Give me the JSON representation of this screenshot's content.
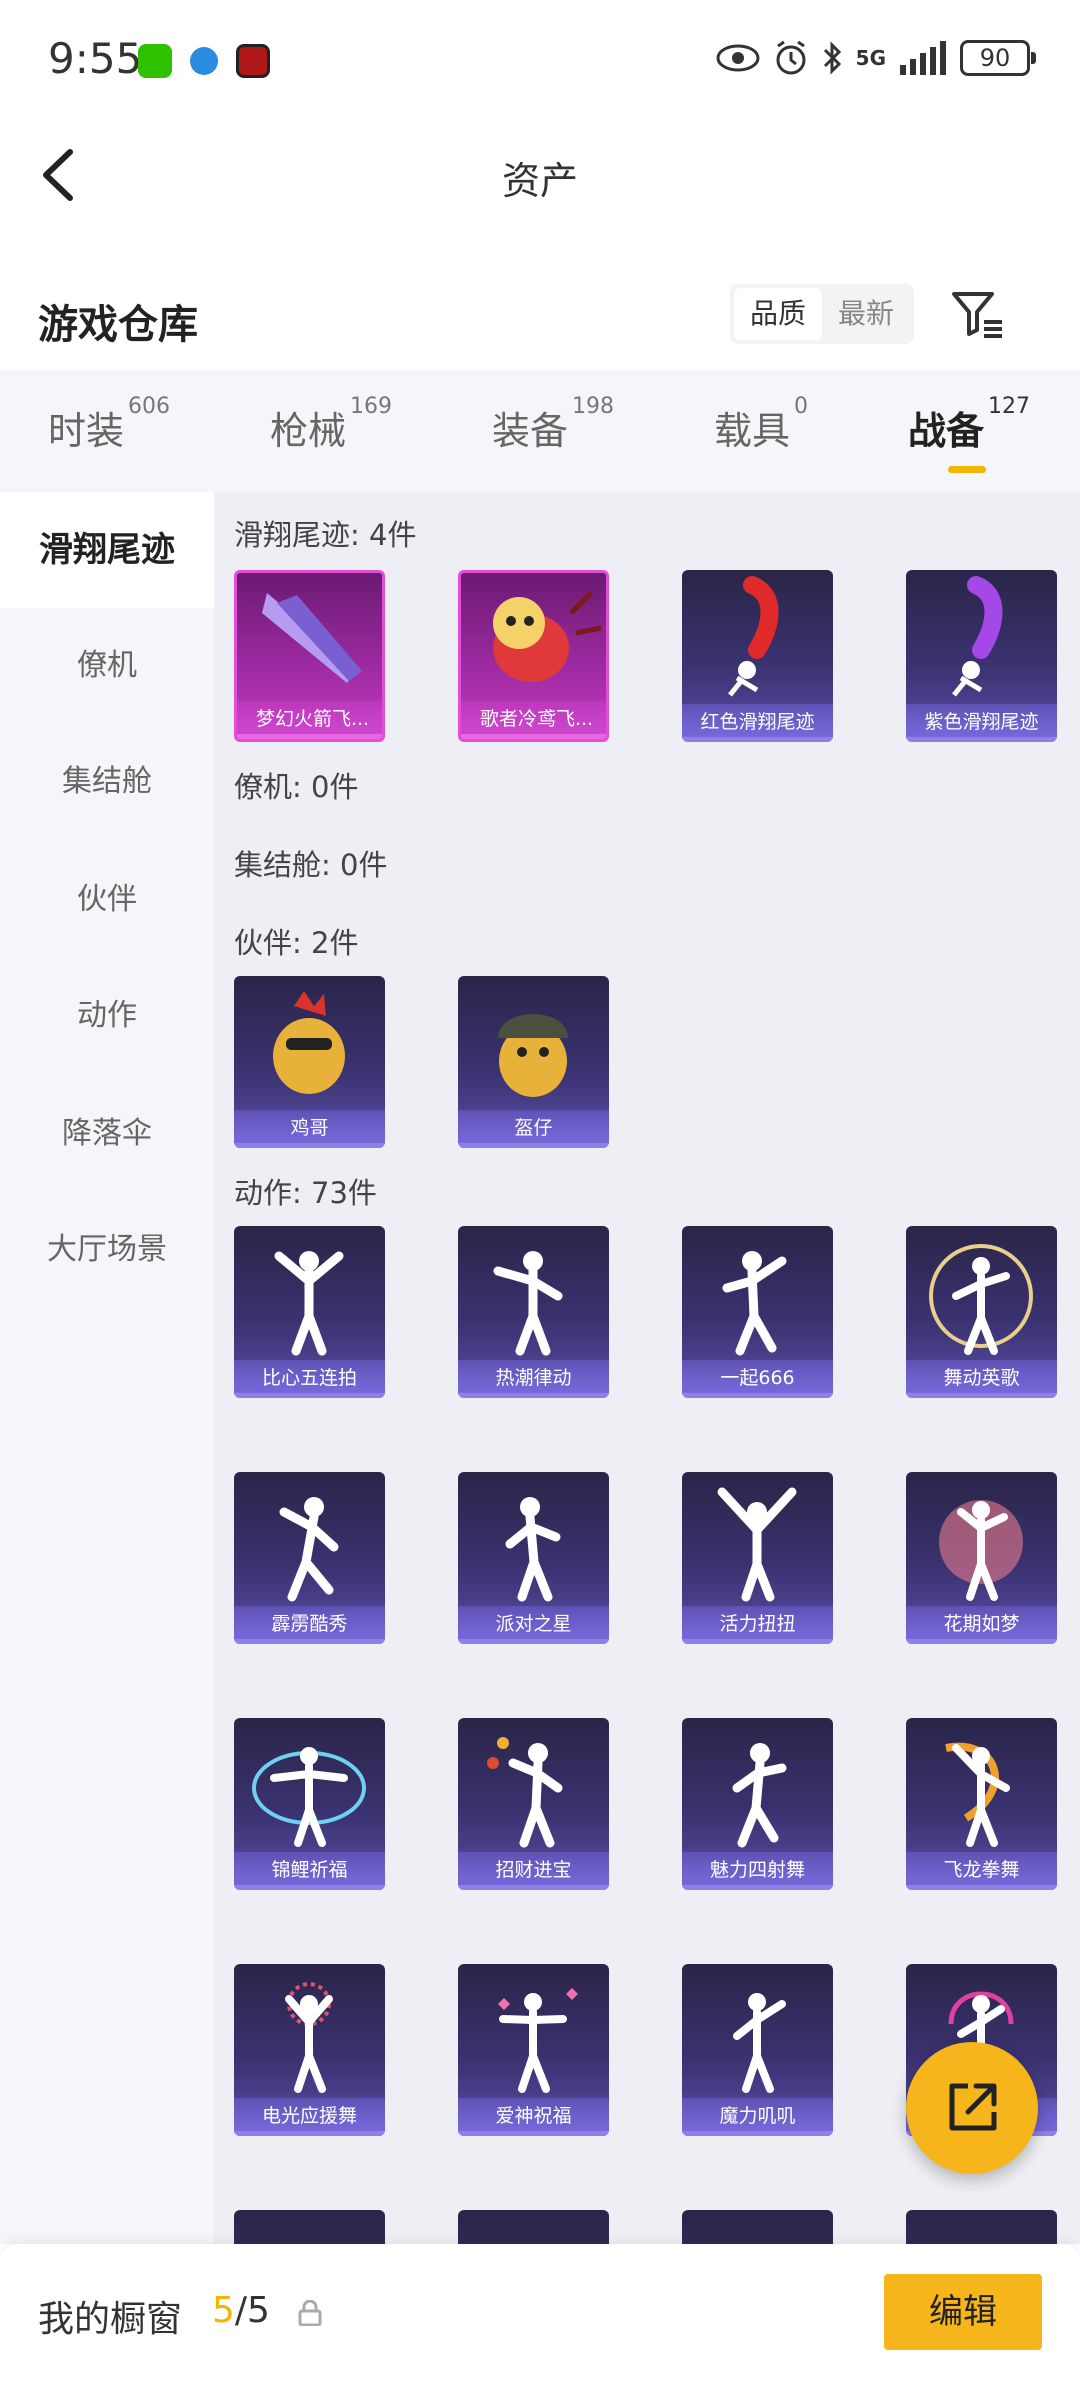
{
  "status_bar": {
    "time": "9:55",
    "network": "5G",
    "battery": "90",
    "app_icons": [
      "wechat-icon",
      "browser-icon",
      "game-app-icon"
    ],
    "system_icons": [
      "eye-icon",
      "alarm-icon",
      "bluetooth-icon",
      "signal-icon",
      "battery-icon"
    ]
  },
  "nav": {
    "title": "资产",
    "back_icon": "chevron-left-icon"
  },
  "warehouse": {
    "title": "游戏仓库",
    "sort_options": [
      "品质",
      "最新"
    ],
    "selected_sort": "品质",
    "filter_icon": "filter-icon"
  },
  "tabs": [
    {
      "label": "时装",
      "count": "606"
    },
    {
      "label": "枪械",
      "count": "169"
    },
    {
      "label": "装备",
      "count": "198"
    },
    {
      "label": "载具",
      "count": "0"
    },
    {
      "label": "战备",
      "count": "127",
      "active": true
    }
  ],
  "sidebar": {
    "items": [
      "滑翔尾迹",
      "僚机",
      "集结舱",
      "伙伴",
      "动作",
      "降落伞",
      "大厅场景"
    ],
    "active": "滑翔尾迹"
  },
  "sections": {
    "glide_trails": {
      "header": "滑翔尾迹: 4件",
      "items": [
        "梦幻火箭飞...",
        "歌者冷鸢飞...",
        "红色滑翔尾迹",
        "紫色滑翔尾迹"
      ]
    },
    "wingman": {
      "header": "僚机: 0件"
    },
    "assembly_pod": {
      "header": "集结舱: 0件"
    },
    "partners": {
      "header": "伙伴: 2件",
      "items": [
        "鸡哥",
        "盔仔"
      ]
    },
    "emotes": {
      "header": "动作: 73件",
      "items": [
        "比心五连拍",
        "热潮律动",
        "一起666",
        "舞动英歌",
        "霹雳酷秀",
        "派对之星",
        "活力扭扭",
        "花期如梦",
        "锦鲤祈福",
        "招财进宝",
        "魅力四射舞",
        "飞龙拳舞",
        "电光应援舞",
        "爱神祝福",
        "魔力叽叽",
        ""
      ]
    }
  },
  "fab": {
    "icon": "share-external-icon"
  },
  "bottom_bar": {
    "title": "我的橱窗",
    "count_current": "5",
    "count_separator": "/",
    "count_total": "5",
    "lock_icon": "lock-icon",
    "edit_label": "编辑"
  },
  "colors": {
    "accent": "#f6b51a",
    "tab_underline": "#f4b400",
    "rare_item": "#c43bbf",
    "item_base": "#3a3270"
  }
}
